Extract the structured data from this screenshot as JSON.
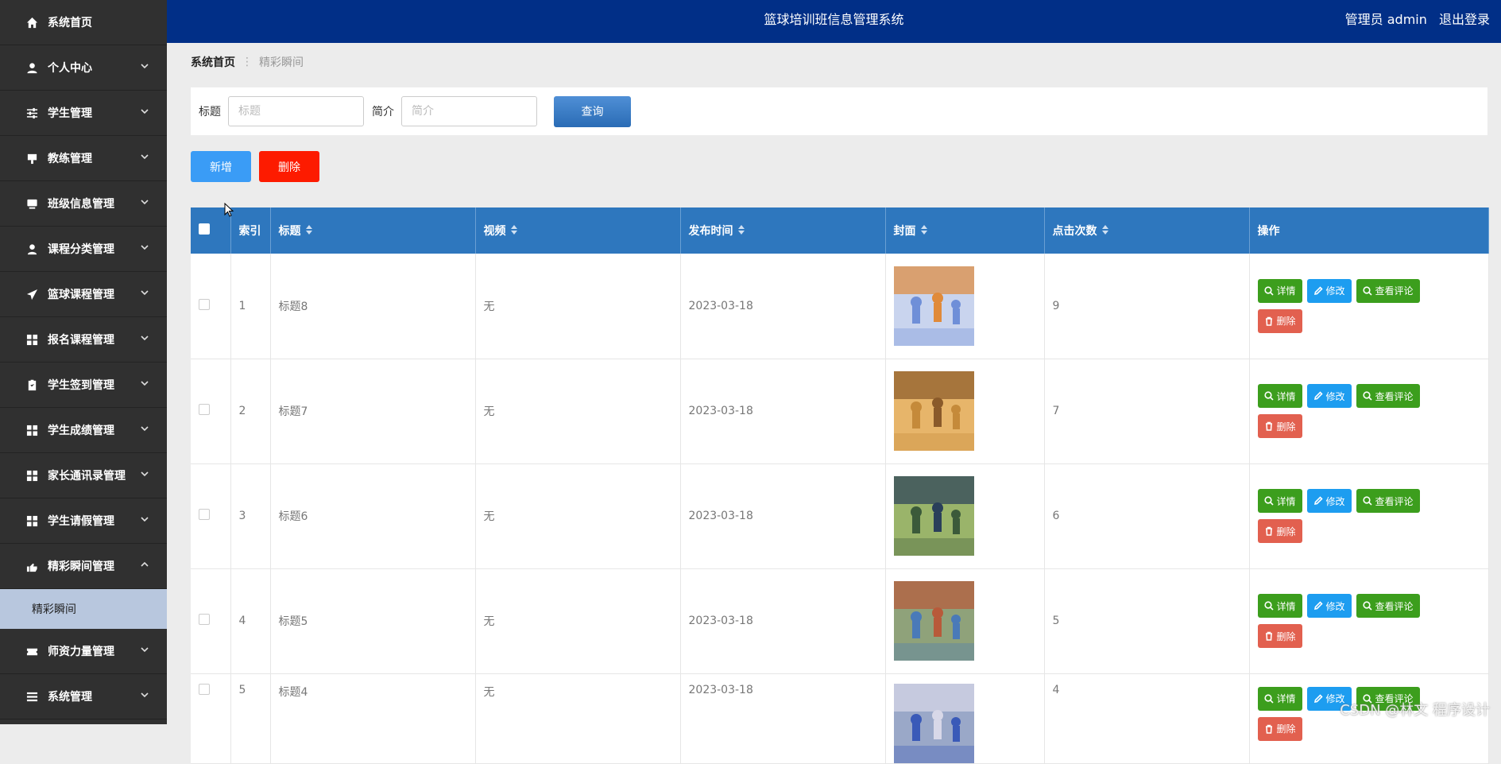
{
  "app": {
    "title": "篮球培训班信息管理系统",
    "user_label": "管理员 admin",
    "logout_label": "退出登录"
  },
  "sidebar": {
    "items": [
      {
        "label": "系统首页",
        "icon": "home-icon"
      },
      {
        "label": "个人中心",
        "icon": "user-icon"
      },
      {
        "label": "学生管理",
        "icon": "sliders-icon"
      },
      {
        "label": "教练管理",
        "icon": "board-icon"
      },
      {
        "label": "班级信息管理",
        "icon": "monitor-icon"
      },
      {
        "label": "课程分类管理",
        "icon": "person-icon"
      },
      {
        "label": "篮球课程管理",
        "icon": "send-icon"
      },
      {
        "label": "报名课程管理",
        "icon": "grid-icon"
      },
      {
        "label": "学生签到管理",
        "icon": "clipboard-icon"
      },
      {
        "label": "学生成绩管理",
        "icon": "grid-icon"
      },
      {
        "label": "家长通讯录管理",
        "icon": "grid-icon"
      },
      {
        "label": "学生请假管理",
        "icon": "grid-icon"
      },
      {
        "label": "精彩瞬间管理",
        "icon": "hand-icon"
      },
      {
        "label": "师资力量管理",
        "icon": "ticket-icon"
      },
      {
        "label": "系统管理",
        "icon": "list-icon"
      }
    ],
    "active_sub": "精彩瞬间"
  },
  "breadcrumb": {
    "home": "系统首页",
    "separator": "⋮",
    "current": "精彩瞬间"
  },
  "search": {
    "title_label": "标题",
    "title_placeholder": "标题",
    "title_value": "",
    "intro_label": "简介",
    "intro_placeholder": "简介",
    "intro_value": "",
    "query_label": "查询"
  },
  "toolbar": {
    "add_label": "新增",
    "delete_label": "删除"
  },
  "table": {
    "columns": [
      "索引",
      "标题",
      "视频",
      "发布时间",
      "封面",
      "点击次数",
      "操作"
    ],
    "rows": [
      {
        "index": "1",
        "title": "标题8",
        "video": "无",
        "date": "2023-03-18",
        "clicks": "9"
      },
      {
        "index": "2",
        "title": "标题7",
        "video": "无",
        "date": "2023-03-18",
        "clicks": "7"
      },
      {
        "index": "3",
        "title": "标题6",
        "video": "无",
        "date": "2023-03-18",
        "clicks": "6"
      },
      {
        "index": "4",
        "title": "标题5",
        "video": "无",
        "date": "2023-03-18",
        "clicks": "5"
      },
      {
        "index": "5",
        "title": "标题4",
        "video": "无",
        "date": "2023-03-18",
        "clicks": "4"
      }
    ],
    "ops": {
      "detail": "详情",
      "edit": "修改",
      "comment": "查看评论",
      "delete": "删除"
    }
  },
  "watermark": "CSDN @林文 程序设计",
  "colors": {
    "header": "#012f87",
    "sidebar": "#303030",
    "table_head": "#2e77be",
    "add": "#3a9cf6",
    "delete": "#fd1b00",
    "green_op": "#3c9e1d",
    "blue_op": "#1d9df0",
    "red_op": "#e2604f"
  }
}
